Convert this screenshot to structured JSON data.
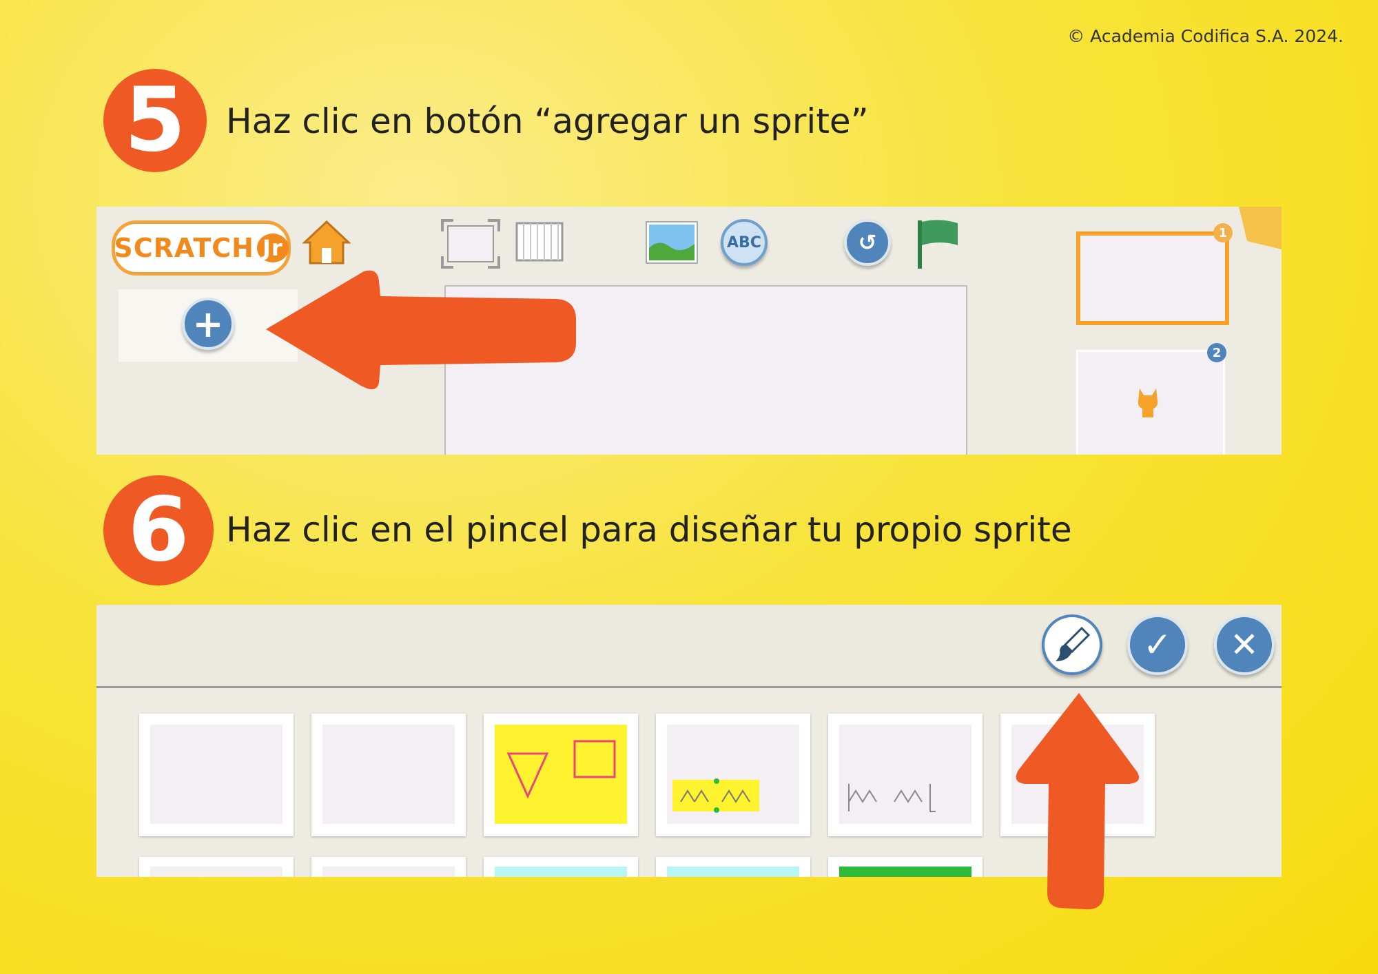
{
  "copyright": "© Academia Codifica S.A. 2024.",
  "steps": [
    {
      "number": "5",
      "text": "Haz clic en botón “agregar un sprite”"
    },
    {
      "number": "6",
      "text": "Haz clic en el pincel para diseñar tu propio sprite"
    }
  ],
  "scratchjr": {
    "logo": "SCRATCH",
    "logo_suffix": "Jr",
    "pages": [
      {
        "number": "1",
        "selected": true
      },
      {
        "number": "2",
        "selected": false
      }
    ],
    "add_sprite_symbol": "+",
    "flag_color": "#3f9a5b"
  },
  "library": {
    "tile_colors": [
      "#f3eff5",
      "#f3eff5",
      "#fff22e",
      "#f3eff5",
      "#f3eff5",
      "#f3eff5"
    ],
    "second_row_colors": [
      "#f3eff5",
      "#f3eff5",
      "#b8f5f7",
      "#b8f5f7",
      "#2dba3a"
    ]
  },
  "colors": {
    "accent_orange": "#ef5a24",
    "button_blue": "#4f85ba",
    "background_yellow": "#f7db0e"
  }
}
